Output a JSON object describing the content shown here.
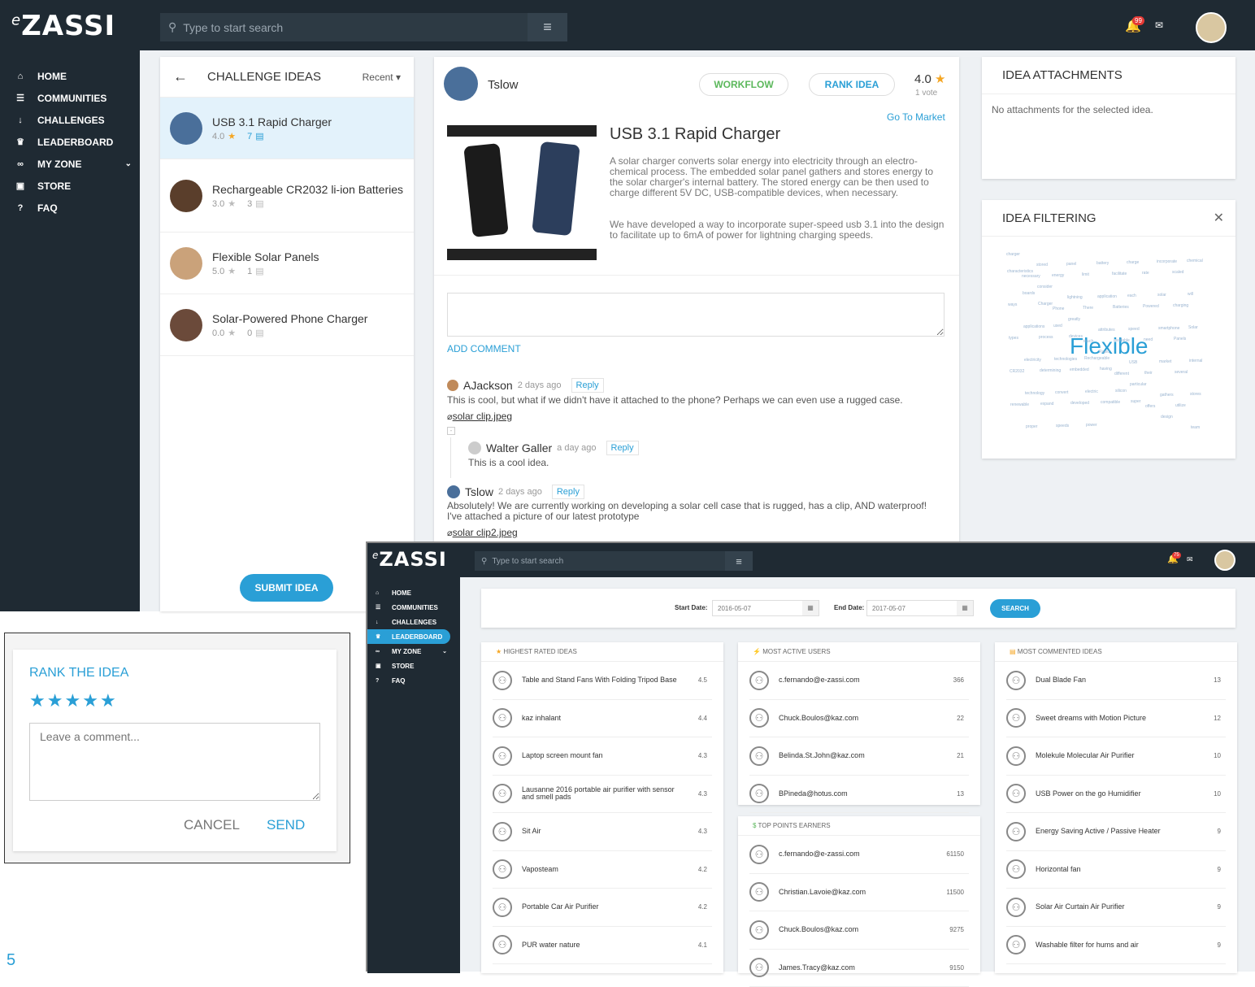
{
  "main": {
    "logo": "ZASSI",
    "logo_prefix": "e",
    "search_placeholder": "Type to start search",
    "notif_count": "99",
    "nav": [
      {
        "label": "HOME",
        "icon": "home-icon",
        "glyph": "⌂"
      },
      {
        "label": "COMMUNITIES",
        "icon": "communities-icon",
        "glyph": "☰"
      },
      {
        "label": "CHALLENGES",
        "icon": "challenges-icon",
        "glyph": "↓"
      },
      {
        "label": "LEADERBOARD",
        "icon": "trophy-icon",
        "glyph": "♛"
      },
      {
        "label": "MY ZONE",
        "icon": "myzone-icon",
        "glyph": "∞"
      },
      {
        "label": "STORE",
        "icon": "store-icon",
        "glyph": "▣"
      },
      {
        "label": "FAQ",
        "icon": "faq-icon",
        "glyph": "?"
      }
    ]
  },
  "ideas_panel": {
    "title": "CHALLENGE IDEAS",
    "sort": "Recent",
    "items": [
      {
        "title": "USB 3.1 Rapid Charger",
        "rating": "4.0",
        "comments": "7"
      },
      {
        "title": "Rechargeable CR2032 li-ion Batteries",
        "rating": "3.0",
        "comments": "3"
      },
      {
        "title": "Flexible Solar Panels",
        "rating": "5.0",
        "comments": "1"
      },
      {
        "title": "Solar-Powered Phone Charger",
        "rating": "0.0",
        "comments": "0"
      }
    ],
    "submit": "SUBMIT IDEA"
  },
  "idea": {
    "author": "Tslow",
    "workflow": "WORKFLOW",
    "rank": "RANK IDEA",
    "score": "4.0",
    "votes": "1 vote",
    "stage": "Go To Market",
    "title": "USB 3.1 Rapid Charger",
    "desc1": "A solar charger converts solar energy into electricity through an electro-chemical process. The embedded solar panel gathers and stores energy to the solar charger's internal battery. The stored energy can be then used to charge different 5V DC, USB-compatible devices, when necessary.",
    "desc2": "We have developed a way to incorporate super-speed usb 3.1 into the design to facilitate up to 6mA of power for lightning charging speeds.",
    "add_comment": "ADD COMMENT",
    "comments": [
      {
        "author": "AJackson",
        "time": "2 days ago",
        "reply": "Reply",
        "text": "This is cool, but what if we didn't have it attached to the phone? Perhaps we can even use a rugged case.",
        "attach": "solar clip.jpeg"
      },
      {
        "author": "Walter Galler",
        "time": "a day ago",
        "reply": "Reply",
        "text": "This is a cool idea."
      },
      {
        "author": "Tslow",
        "time": "2 days ago",
        "reply": "Reply",
        "text": "Absolutely! We are currently working on developing a solar cell case that is rugged, has a clip, AND waterproof! I've attached a picture of our latest prototype",
        "attach": "solar clip2.jpeg"
      }
    ]
  },
  "attachments": {
    "title": "IDEA ATTACHMENTS",
    "empty": "No attachments for the selected idea."
  },
  "filtering": {
    "title": "IDEA FILTERING",
    "big_word": "Flexible",
    "words": [
      "charger",
      "stored",
      "panel",
      "battery",
      "charge",
      "incorporate",
      "chemical",
      "necessary",
      "energy",
      "limit",
      "facilitate",
      "rate",
      "scaled",
      "characteristics",
      "consider",
      "lightning",
      "application",
      "each",
      "solar",
      "will",
      "boards",
      "Phone",
      "There",
      "Batteries",
      "Powered",
      "charging",
      "ways",
      "Charger",
      "greatly",
      "attributes",
      "speed",
      "smartphone",
      "Solar",
      "applications",
      "used",
      "touch",
      "available",
      "need",
      "Panels",
      "types",
      "process",
      "devices",
      "Rapid",
      "USB",
      "market",
      "internal",
      "electricity",
      "technologies",
      "Rechargeable",
      "different",
      "their",
      "several",
      "CR2032",
      "determining",
      "embedded",
      "having",
      "particular",
      "gathers",
      "stores",
      "technology",
      "convert",
      "electric",
      "silicon",
      "offers",
      "utilize",
      "renewable",
      "expand",
      "developed",
      "compatible",
      "super",
      "design",
      "team",
      "proper",
      "speeds",
      "power"
    ]
  },
  "rank_dialog": {
    "title": "RANK THE IDEA",
    "placeholder": "Leave a comment...",
    "cancel": "CANCEL",
    "send": "SEND",
    "page_number": "5"
  },
  "leaderboard": {
    "search_placeholder": "Type to start search",
    "notif_count": "75",
    "nav": [
      "HOME",
      "COMMUNITIES",
      "CHALLENGES",
      "LEADERBOARD",
      "MY ZONE",
      "STORE",
      "FAQ"
    ],
    "start_label": "Start Date:",
    "start_value": "2016-05-07",
    "end_label": "End Date:",
    "end_value": "2017-05-07",
    "search_btn": "SEARCH",
    "highest_title": "HIGHEST RATED IDEAS",
    "highest": [
      {
        "name": "Table and Stand Fans With Folding Tripod Base",
        "v": "4.5"
      },
      {
        "name": "kaz inhalant",
        "v": "4.4"
      },
      {
        "name": "Laptop screen mount fan",
        "v": "4.3"
      },
      {
        "name": "Lausanne 2016 portable air purifier with sensor and smell pads",
        "v": "4.3"
      },
      {
        "name": "Sit Air",
        "v": "4.3"
      },
      {
        "name": "Vaposteam",
        "v": "4.2"
      },
      {
        "name": "Portable Car Air Purifier",
        "v": "4.2"
      },
      {
        "name": "PUR water nature",
        "v": "4.1"
      }
    ],
    "active_title": "MOST ACTIVE USERS",
    "active": [
      {
        "name": "c.fernando@e-zassi.com",
        "v": "366"
      },
      {
        "name": "Chuck.Boulos@kaz.com",
        "v": "22"
      },
      {
        "name": "Belinda.St.John@kaz.com",
        "v": "21"
      },
      {
        "name": "BPineda@hotus.com",
        "v": "13"
      }
    ],
    "earners_title": "TOP POINTS EARNERS",
    "earners": [
      {
        "name": "c.fernando@e-zassi.com",
        "v": "61150"
      },
      {
        "name": "Christian.Lavoie@kaz.com",
        "v": "11500"
      },
      {
        "name": "Chuck.Boulos@kaz.com",
        "v": "9275"
      },
      {
        "name": "James.Tracy@kaz.com",
        "v": "9150"
      }
    ],
    "commented_title": "MOST COMMENTED IDEAS",
    "commented": [
      {
        "name": "Dual Blade Fan",
        "v": "13"
      },
      {
        "name": "Sweet dreams with Motion Picture",
        "v": "12"
      },
      {
        "name": "Molekule Molecular Air Purifier",
        "v": "10"
      },
      {
        "name": "USB Power on the go Humidifier",
        "v": "10"
      },
      {
        "name": "Energy Saving Active / Passive Heater",
        "v": "9"
      },
      {
        "name": "Horizontal fan",
        "v": "9"
      },
      {
        "name": "Solar Air Curtain Air Purifier",
        "v": "9"
      },
      {
        "name": "Washable filter for hums and air",
        "v": "9"
      }
    ]
  },
  "colors": {
    "accent": "#2a9fd6",
    "dark": "#1f2a33",
    "star": "#f5a623",
    "selected": "#e3f2fb"
  }
}
